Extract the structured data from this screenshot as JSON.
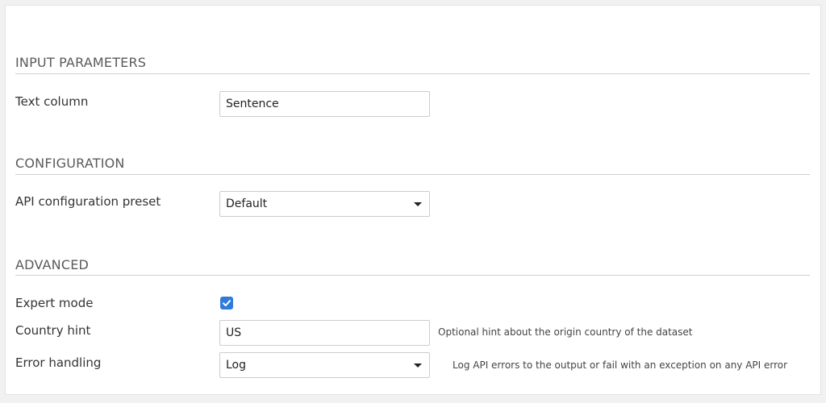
{
  "sections": {
    "input_parameters": {
      "title": "INPUT PARAMETERS",
      "text_column": {
        "label": "Text column",
        "value": "Sentence"
      }
    },
    "configuration": {
      "title": "CONFIGURATION",
      "api_preset": {
        "label": "API configuration preset",
        "value": "Default"
      }
    },
    "advanced": {
      "title": "ADVANCED",
      "expert_mode": {
        "label": "Expert mode",
        "checked": true
      },
      "country_hint": {
        "label": "Country hint",
        "value": "US",
        "help": "Optional hint about the origin country of the dataset"
      },
      "error_handling": {
        "label": "Error handling",
        "value": "Log",
        "help": "Log API errors to the output or fail with an exception on any API error"
      }
    }
  },
  "colors": {
    "accent": "#2f7bdc",
    "border": "#cccccc",
    "rule": "#cfcfcf"
  },
  "icons": {
    "dropdown": "chevron-down-icon",
    "check": "checkmark-icon"
  }
}
